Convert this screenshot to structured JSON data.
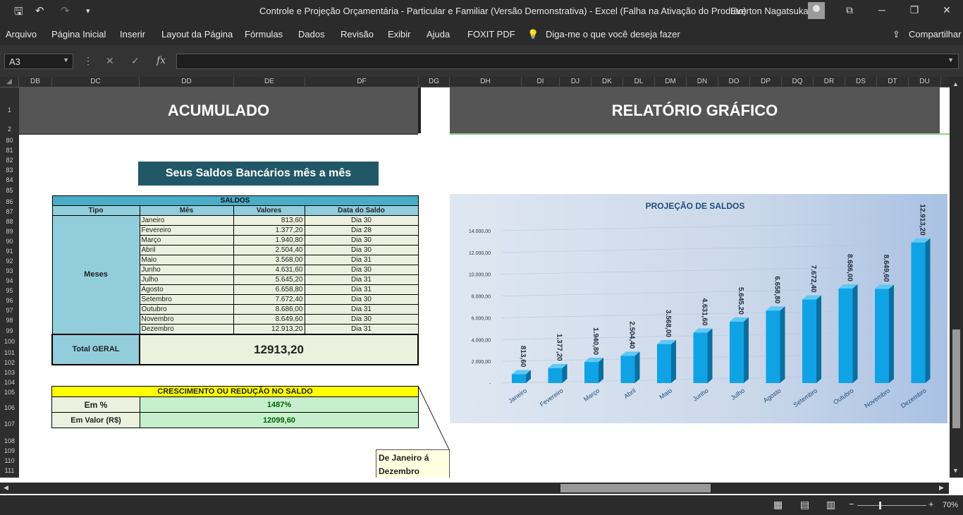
{
  "titlebar": {
    "title": "Controle e Projeção Orçamentária - Particular e Familiar (Versão Demonstrativa)  -  Excel (Falha na Ativação do Produto)",
    "user": "Everton Nagatsuka"
  },
  "menu": [
    "Arquivo",
    "Página Inicial",
    "Inserir",
    "Layout da Página",
    "Fórmulas",
    "Dados",
    "Revisão",
    "Exibir",
    "Ajuda",
    "FOXIT PDF"
  ],
  "tell_me": "Diga-me o que você deseja fazer",
  "share": "Compartilhar",
  "namebox": "A3",
  "columns": [
    "DB",
    "DC",
    "DD",
    "DE",
    "DF",
    "DG",
    "DH",
    "DI",
    "DJ",
    "DK",
    "DL",
    "DM",
    "DN",
    "DO",
    "DP",
    "DQ",
    "DR",
    "DS",
    "DT",
    "DU"
  ],
  "rows": [
    "1",
    "2",
    "80",
    "81",
    "82",
    "83",
    "84",
    "85",
    "86",
    "87",
    "88",
    "89",
    "90",
    "91",
    "92",
    "93",
    "94",
    "95",
    "96",
    "97",
    "98",
    "99",
    "100",
    "101",
    "102",
    "103",
    "104",
    "105",
    "106",
    "107",
    "108",
    "109",
    "110",
    "111"
  ],
  "banners": {
    "acumulado": "ACUMULADO",
    "relatorio": "RELATÓRIO GRÁFICO"
  },
  "section_title": "Seus Saldos Bancários mês a mês",
  "saldos": {
    "title": "SALDOS",
    "headers": [
      "Tipo",
      "Mês",
      "Valores",
      "Data do Saldo"
    ],
    "tipo": "Meses",
    "rows": [
      {
        "mes": "Janeiro",
        "valor": "813,60",
        "data": "Dia 30"
      },
      {
        "mes": "Fevereiro",
        "valor": "1.377,20",
        "data": "Dia 28"
      },
      {
        "mes": "Março",
        "valor": "1.940,80",
        "data": "Dia 30"
      },
      {
        "mes": "Abril",
        "valor": "2.504,40",
        "data": "Dia 30"
      },
      {
        "mes": "Maio",
        "valor": "3.568,00",
        "data": "Dia 31"
      },
      {
        "mes": "Junho",
        "valor": "4.631,60",
        "data": "Dia 30"
      },
      {
        "mes": "Julho",
        "valor": "5.645,20",
        "data": "Dia 31"
      },
      {
        "mes": "Agosto",
        "valor": "6.658,80",
        "data": "Dia 31"
      },
      {
        "mes": "Setembro",
        "valor": "7.672,40",
        "data": "Dia 30"
      },
      {
        "mes": "Outubro",
        "valor": "8.686,00",
        "data": "Dia 31"
      },
      {
        "mes": "Novembro",
        "valor": "8.649,60",
        "data": "Dia 30"
      },
      {
        "mes": "Dezembro",
        "valor": "12.913,20",
        "data": "Dia 31"
      }
    ],
    "total_label": "Total GERAL",
    "total_value": "12913,20"
  },
  "crescimento": {
    "title": "CRESCIMENTO OU REDUÇÃO NO SALDO",
    "pct_label": "Em %",
    "pct_value": "1487%",
    "valor_label": "Em Valor (R$)",
    "valor_value": "12099,60"
  },
  "callout": "De Janeiro á Dezembro",
  "chart_data": {
    "type": "bar",
    "title": "PROJEÇÃO DE SALDOS",
    "categories": [
      "Janeiro",
      "Fevereiro",
      "Março",
      "Abril",
      "Maio",
      "Junho",
      "Julho",
      "Agosto",
      "Setembro",
      "Outubro",
      "Novembro",
      "Dezembro"
    ],
    "values": [
      813.6,
      1377.2,
      1940.8,
      2504.4,
      3568.0,
      4631.6,
      5645.2,
      6658.8,
      7672.4,
      8686.0,
      8649.6,
      12913.2
    ],
    "labels": [
      "813,60",
      "1.377,20",
      "1.940,80",
      "2.504,40",
      "3.568,00",
      "4.631,60",
      "5.645,20",
      "6.658,80",
      "7.672,40",
      "8.686,00",
      "8.649,60",
      "12.913,20"
    ],
    "yticks": [
      "-",
      "2.000,00",
      "4.000,00",
      "6.000,00",
      "8.000,00",
      "10.000,00",
      "12.000,00",
      "14.000,00"
    ],
    "ylim": [
      0,
      14000
    ],
    "bar_color": "#0fa3e6"
  },
  "status": {
    "zoom": "70%"
  }
}
